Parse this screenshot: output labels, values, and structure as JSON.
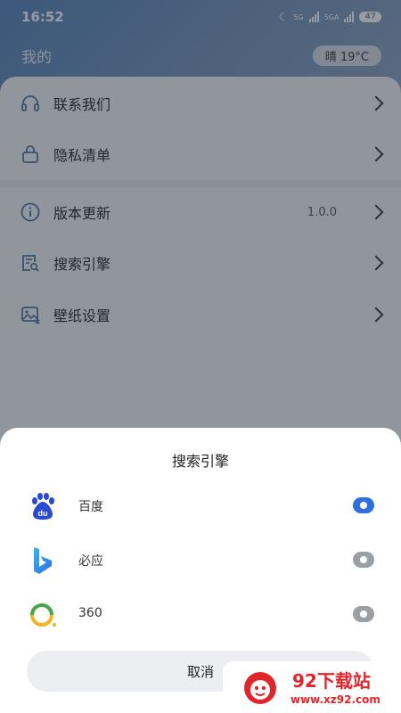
{
  "status_bar": {
    "time": "16:52",
    "network_1": "5G",
    "network_2": "5GA",
    "battery": "47"
  },
  "header": {
    "title": "我的",
    "weather": "晴 19°C"
  },
  "menu": [
    {
      "label": "联系我们",
      "icon": "headset-icon"
    },
    {
      "label": "隐私清单",
      "icon": "lock-icon"
    },
    {
      "label": "版本更新",
      "icon": "info-icon",
      "value": "1.0.0"
    },
    {
      "label": "搜索引擎",
      "icon": "search-doc-icon"
    },
    {
      "label": "壁纸设置",
      "icon": "wallpaper-icon"
    }
  ],
  "sheet": {
    "title": "搜索引擎",
    "engines": [
      {
        "label": "百度",
        "icon": "baidu-logo",
        "selected": true
      },
      {
        "label": "必应",
        "icon": "bing-logo",
        "selected": false
      },
      {
        "label": "360",
        "icon": "360-logo",
        "selected": false
      }
    ],
    "cancel": "取消"
  },
  "watermark": {
    "name": "92下载站",
    "url": "www.xz92.com"
  },
  "colors": {
    "accent": "#2f6fe0",
    "radio_off": "#9aa0a6",
    "watermark": "#e0262b"
  }
}
